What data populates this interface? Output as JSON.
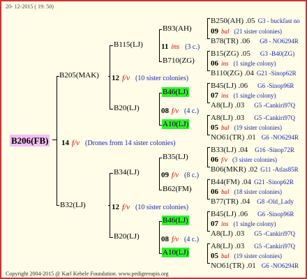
{
  "date": "20- 12-2015 ( 19: 50)",
  "footer": "Copyright 2004-2015 @ Karl Kehele Foundation.   www.pedigreeapis.org",
  "root": "B206(FB)",
  "root_info": {
    "count": "14",
    "mark": "f/v",
    "text": "(Drones from 14 sister colonies)"
  },
  "gen1": [
    {
      "name": "B205(MAK)",
      "count": "12",
      "mark": "f/v",
      "text": "(10 sister colonies)"
    },
    {
      "name": "B32(LJ)",
      "count": "12",
      "mark": "f/v",
      "text": "(10 sister colonies)"
    }
  ],
  "gen2": [
    {
      "name": "B115(LJ)",
      "count": "11",
      "mark": "ins",
      "text": "(3 c.)"
    },
    {
      "name": "B20(LJ)",
      "count": "08",
      "mark": "f/v",
      "text": "(4 c.)"
    },
    {
      "name": "B34(LJ)",
      "count": "09",
      "mark": "f/v",
      "text": "(8 c.)"
    },
    {
      "name": "B20(LJ)",
      "count": "08",
      "mark": "f/v",
      "text": "(4 c.)"
    }
  ],
  "gen3": [
    "B93(AH)",
    "B710(ZG)",
    "B46(LJ)",
    "A10(LJ)",
    "B35(LJ)",
    "B62(FM)",
    "B46(LJ)",
    "A10(LJ)"
  ],
  "gen4": [
    {
      "a": "B250(AH) .05",
      "ab": "G3 - buckfast no",
      "c": "09",
      "m": "bal",
      "i": "(21 sister colonies)",
      "b": "B78(TR) .06",
      "bb": "G8 - NO6294R"
    },
    {
      "a": "B15(ZG) .05",
      "ab": "G3 -B40(ZG)",
      "c": "06",
      "m": "ins",
      "i": "(1 single colony)",
      "b": "B110(ZG) .04",
      "bb": "G21 -Sinop62R"
    },
    {
      "a": "B45(LJ) .06",
      "ab": "G6 -Sinop96R",
      "c": "07",
      "m": "ins",
      "i": "(1 single colony)",
      "b": "A8(LJ) .03",
      "bb": "G5 -Cankiri97Q"
    },
    {
      "a": "A8(LJ) .03",
      "ab": "G5 -Cankiri97Q",
      "c": "05",
      "m": "bal",
      "i": "(19 sister colonies)",
      "b": "NO61(TR) .01",
      "bb": "G6 -NO6294R"
    },
    {
      "a": "B33(LJ) .04",
      "ab": "G16 -Sinop72R",
      "c": "06",
      "m": "f/v",
      "i": "(3 sister colonies)",
      "b": "B06(MKR) .02",
      "bb": "G11 -Atlas85R"
    },
    {
      "a": "B44(FM) .04",
      "ab": "G21 -Sinop62R",
      "c": "06",
      "m": "bal",
      "i": "(18 sister colonies)",
      "b": "B77(TR) .04",
      "bb": "G8 -Old_Lady"
    },
    {
      "a": "B45(LJ) .06",
      "ab": "G6 -Sinop96R",
      "c": "07",
      "m": "ins",
      "i": "(1 single colony)",
      "b": "A8(LJ) .03",
      "bb": "G5 -Cankiri97Q"
    },
    {
      "a": "A8(LJ) .03",
      "ab": "G5 -Cankiri97Q",
      "c": "05",
      "m": "bal",
      "i": "(19 sister colonies)",
      "b": "NO61(TR) .01",
      "bb": "G6 -NO6294R"
    }
  ]
}
